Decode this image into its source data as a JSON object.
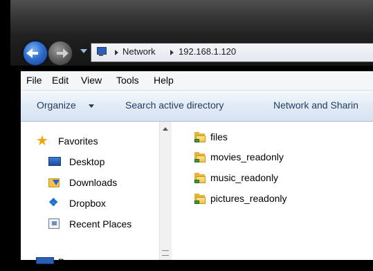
{
  "address_bar": {
    "crumbs": [
      "Network",
      "192.168.1.120"
    ]
  },
  "menu": {
    "items": [
      "File",
      "Edit",
      "View",
      "Tools",
      "Help"
    ]
  },
  "command_bar": {
    "organize": "Organize",
    "search_active_directory": "Search active directory",
    "network_and_sharing": "Network and Sharin"
  },
  "nav_pane": {
    "favorites": "Favorites",
    "items": [
      "Desktop",
      "Downloads",
      "Dropbox",
      "Recent Places"
    ],
    "partial_label": "D"
  },
  "files": [
    "files",
    "movies_readonly",
    "music_readonly",
    "pictures_readonly"
  ],
  "colors": {
    "accent_blue": "#2f6fd0",
    "folder": "#e8b339",
    "command_text": "#1e3a5f"
  }
}
